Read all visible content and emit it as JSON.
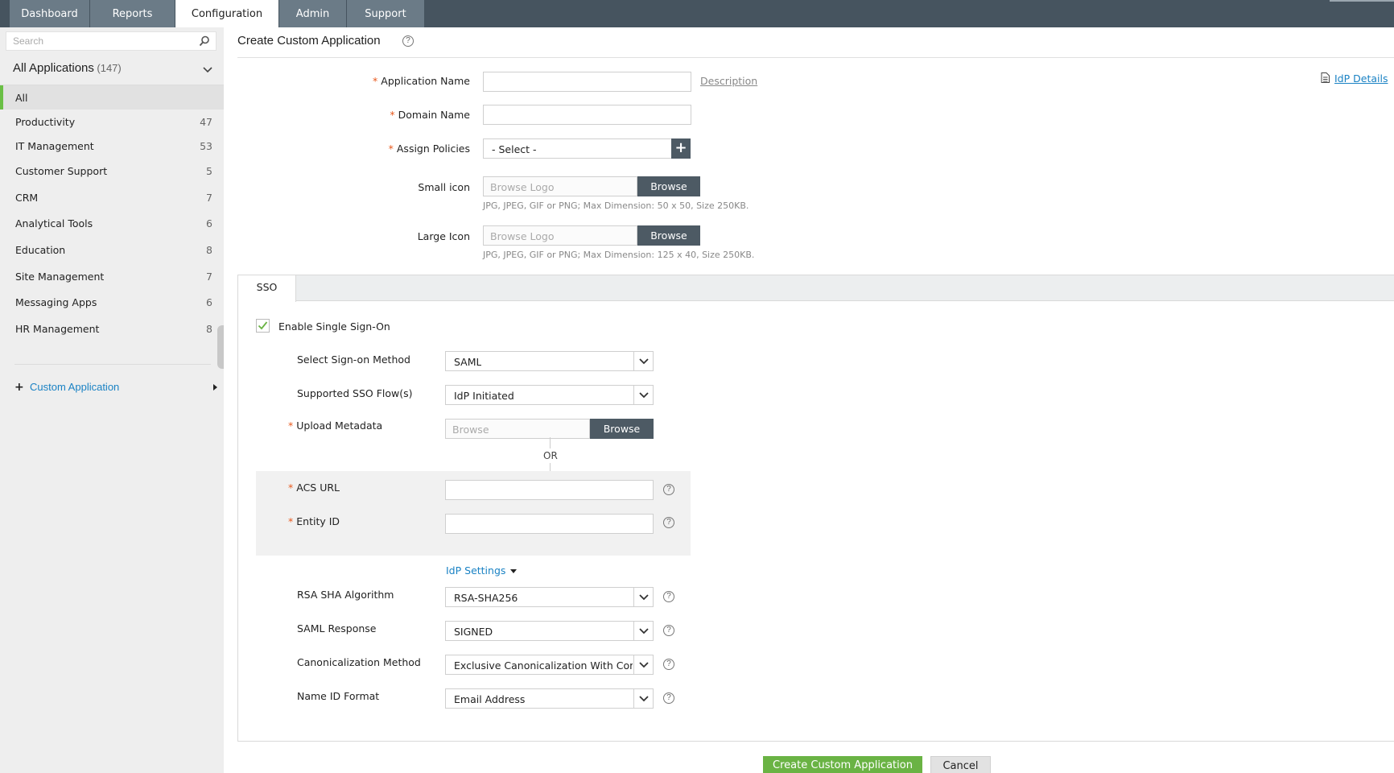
{
  "nav": {
    "tabs": [
      {
        "label": "Dashboard",
        "active": false
      },
      {
        "label": "Reports",
        "active": false
      },
      {
        "label": "Configuration",
        "active": true
      },
      {
        "label": "Admin",
        "active": false
      },
      {
        "label": "Support",
        "active": false
      }
    ]
  },
  "sidebar": {
    "search_placeholder": "Search",
    "apps_title": "All Applications",
    "apps_count": "(147)",
    "categories": [
      {
        "label": "All",
        "count": ""
      },
      {
        "label": "Productivity",
        "count": "47"
      },
      {
        "label": "IT Management",
        "count": "53"
      },
      {
        "label": "Customer Support",
        "count": "5"
      },
      {
        "label": "CRM",
        "count": "7"
      },
      {
        "label": "Analytical Tools",
        "count": "6"
      },
      {
        "label": "Education",
        "count": "8"
      },
      {
        "label": "Site Management",
        "count": "7"
      },
      {
        "label": "Messaging Apps",
        "count": "6"
      },
      {
        "label": "HR Management",
        "count": "8"
      }
    ],
    "custom_app_label": "Custom Application"
  },
  "main": {
    "title": "Create Custom Application",
    "idp_details_label": "IdP Details",
    "description_link": "Description",
    "fields": {
      "app_name_label": "Application Name",
      "domain_name_label": "Domain Name",
      "assign_policies_label": "Assign Policies",
      "assign_policies_value": "- Select -",
      "small_icon_label": "Small icon",
      "small_icon_placeholder": "Browse Logo",
      "small_icon_hint": "JPG, JPEG, GIF or PNG; Max Dimension: 50 x 50, Size 250KB.",
      "large_icon_label": "Large Icon",
      "large_icon_placeholder": "Browse Logo",
      "large_icon_hint": "JPG, JPEG, GIF or PNG; Max Dimension: 125 x 40, Size 250KB.",
      "browse_label": "Browse"
    },
    "sso": {
      "tab_label": "SSO",
      "enable_label": "Enable Single Sign-On",
      "enabled": true,
      "sign_on_method_label": "Select Sign-on Method",
      "sign_on_method_value": "SAML",
      "sso_flows_label": "Supported SSO Flow(s)",
      "sso_flows_value": "IdP Initiated",
      "upload_metadata_label": "Upload Metadata",
      "upload_metadata_placeholder": "Browse",
      "browse_label": "Browse",
      "or_label": "OR",
      "acs_url_label": "ACS URL",
      "entity_id_label": "Entity ID",
      "idp_settings_label": "IdP Settings",
      "rsa_label": "RSA SHA Algorithm",
      "rsa_value": "RSA-SHA256",
      "saml_response_label": "SAML Response",
      "saml_response_value": "SIGNED",
      "canon_label": "Canonicalization Method",
      "canon_value": "Exclusive Canonicalization With Comments",
      "name_id_label": "Name ID Format",
      "name_id_value": "Email Address"
    },
    "actions": {
      "create_label": "Create Custom Application",
      "cancel_label": "Cancel"
    }
  },
  "colors": {
    "topbar": "#46545f",
    "tab_bg": "#6b7b87",
    "accent_green": "#6ab344",
    "link_blue": "#1a82c4",
    "required": "#e8581c",
    "dark_button": "#4d5a64"
  }
}
